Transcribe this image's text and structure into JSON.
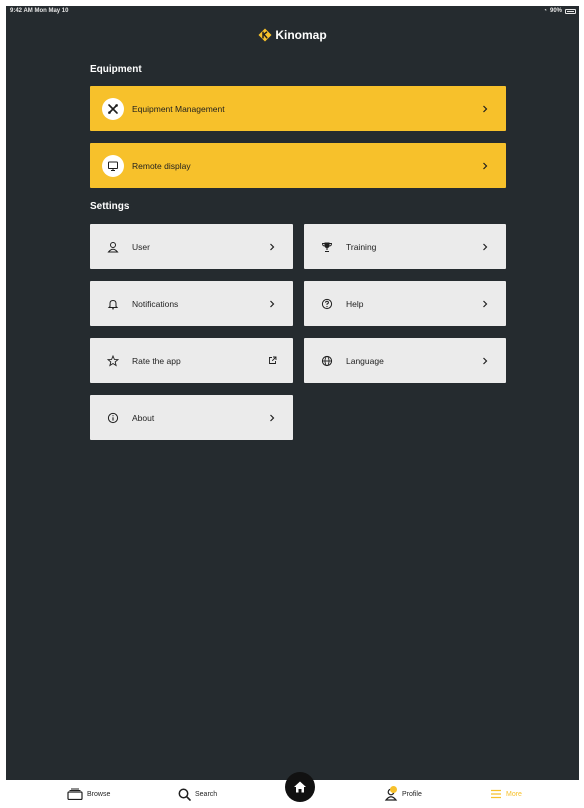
{
  "status_bar": {
    "time": "9:42 AM  Mon May 10",
    "battery": "90%"
  },
  "header": {
    "brand": "Kinomap"
  },
  "equipment": {
    "title": "Equipment",
    "items": [
      {
        "label": "Equipment Management",
        "icon": "tools-icon"
      },
      {
        "label": "Remote display",
        "icon": "monitor-icon"
      }
    ]
  },
  "settings": {
    "title": "Settings",
    "items": [
      {
        "label": "User",
        "icon": "user-icon"
      },
      {
        "label": "Training",
        "icon": "trophy-icon"
      },
      {
        "label": "Notifications",
        "icon": "bell-icon"
      },
      {
        "label": "Help",
        "icon": "question-icon"
      },
      {
        "label": "Rate the app",
        "icon": "star-icon"
      },
      {
        "label": "Language",
        "icon": "globe-icon"
      },
      {
        "label": "About",
        "icon": "info-icon"
      }
    ]
  },
  "tabbar": {
    "items": [
      {
        "label": "Browse",
        "icon": "browse-icon"
      },
      {
        "label": "Search",
        "icon": "search-icon"
      },
      {
        "label": "",
        "icon": "home-icon"
      },
      {
        "label": "Profile",
        "icon": "profile-icon"
      },
      {
        "label": "More",
        "icon": "menu-icon"
      }
    ],
    "active": "More"
  },
  "colors": {
    "background": "#252b2f",
    "accent": "#f7c12b",
    "card": "#ebebeb"
  }
}
